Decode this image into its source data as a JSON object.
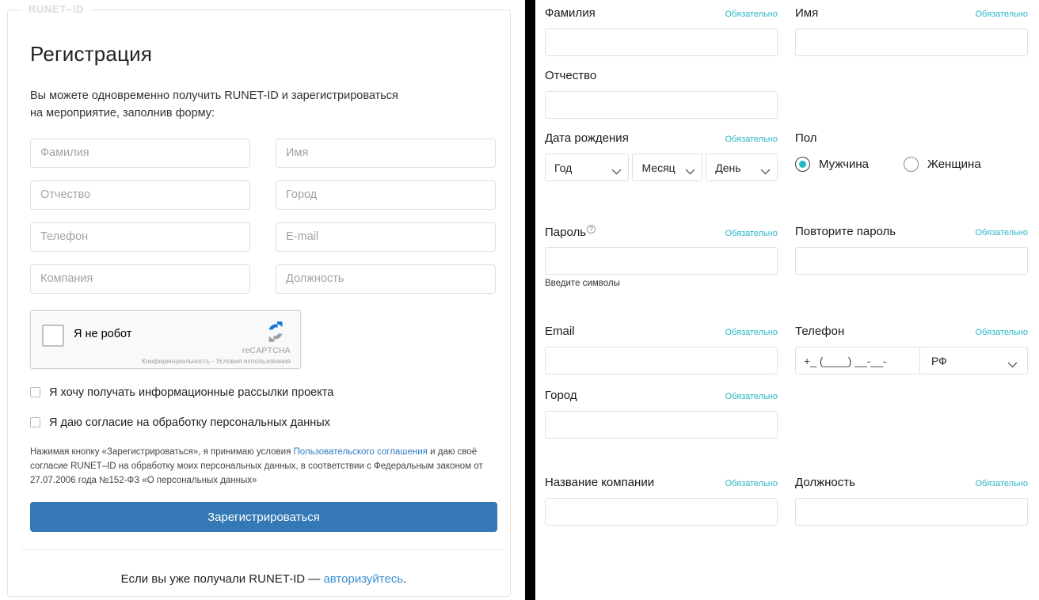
{
  "left": {
    "legend": "RUNET–ID",
    "title": "Регистрация",
    "intro_line1": "Вы можете одновременно получить RUNET-ID и зарегистрироваться",
    "intro_line2": "на мероприятие, заполнив форму:",
    "fields": [
      {
        "name": "lastname",
        "placeholder": "Фамилия",
        "value": ""
      },
      {
        "name": "firstname",
        "placeholder": "Имя",
        "value": ""
      },
      {
        "name": "middlename",
        "placeholder": "Отчество",
        "value": ""
      },
      {
        "name": "city",
        "placeholder": "Город",
        "value": ""
      },
      {
        "name": "phone",
        "placeholder": "Телефон",
        "value": ""
      },
      {
        "name": "email",
        "placeholder": "E-mail",
        "value": ""
      },
      {
        "name": "company",
        "placeholder": "Компания",
        "value": ""
      },
      {
        "name": "position",
        "placeholder": "Должность",
        "value": ""
      }
    ],
    "recaptcha": {
      "label": "Я не робот",
      "brand": "reCAPTCHA",
      "terms": "Конфиденциальность - Условия использования",
      "icon": "recaptcha-logo-icon",
      "checked": false
    },
    "checkbox_newsletter": {
      "label": "Я хочу получать информационные рассылки проекта",
      "checked": false
    },
    "checkbox_personal_data": {
      "label": "Я даю согласие на обработку персональных данных",
      "checked": false
    },
    "legal": {
      "part1": "Нажимая кнопку «Зарегистрироваться», я принимаю условия ",
      "link": "Пользовательского соглашения",
      "part2": " и даю своё согласие RUNET–ID на обработку моих персональных данных, в соответствии с Федеральным законом от 27.07.2006 года №152-ФЗ «О персональных данных»"
    },
    "submit_label": "Зарегистрироваться",
    "footer": {
      "text": "Если вы уже получали RUNET-ID — ",
      "link": "авторизуйтесь",
      "tail": "."
    }
  },
  "right": {
    "required_label": "Обязательно",
    "lastname": {
      "label": "Фамилия",
      "value": "",
      "required": true
    },
    "firstname": {
      "label": "Имя",
      "value": "",
      "required": true
    },
    "middlename": {
      "label": "Отчество",
      "value": "",
      "required": false
    },
    "birthdate": {
      "label": "Дата рождения",
      "required": true,
      "year": "Год",
      "month": "Месяц",
      "day": "День"
    },
    "gender": {
      "label": "Пол",
      "male": "Мужчина",
      "female": "Женщина",
      "selected": "male"
    },
    "password": {
      "label": "Пароль",
      "help_icon": "question-mark-icon",
      "required": true,
      "value": "",
      "hint": "Введите символы"
    },
    "password_repeat": {
      "label": "Повторите пароль",
      "value": "",
      "required": true
    },
    "email": {
      "label": "Email",
      "value": "",
      "required": true
    },
    "phone": {
      "label": "Телефон",
      "required": true,
      "mask": "+_ (____) __-__-",
      "country": "РФ"
    },
    "city": {
      "label": "Город",
      "value": "",
      "required": true
    },
    "company": {
      "label": "Название компании",
      "value": "",
      "required": true
    },
    "position": {
      "label": "Должность",
      "value": "",
      "required": true
    }
  },
  "colors": {
    "required": "#29b6c8",
    "accent_radio": "#22b8cc",
    "submit_button": "#3478b5",
    "link": "#3a8fd0",
    "legal_link": "#2f7dc0",
    "divider": "#000000"
  }
}
